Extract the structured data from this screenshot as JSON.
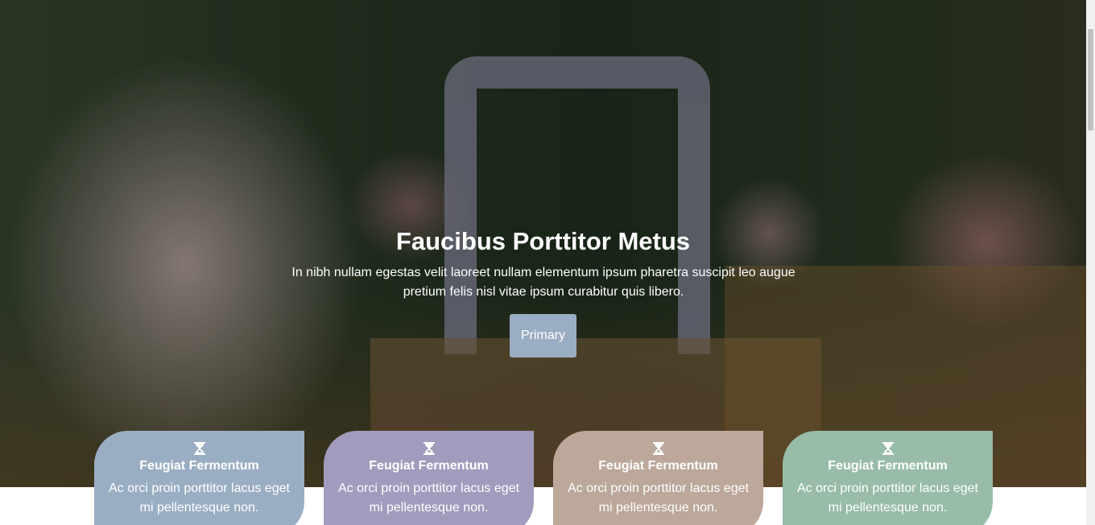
{
  "hero": {
    "title": "Faucibus Porttitor Metus",
    "text": "In nibh nullam egestas velit laoreet nullam elementum ipsum pharetra suscipit leo augue pretium felis nisl vitae ipsum curabitur quis libero.",
    "button_label": "Primary",
    "button_color": "#9aaec3"
  },
  "cards": [
    {
      "icon": "hourglass-icon",
      "title": "Feugiat Fermentum",
      "text": "Ac orci proin porttitor lacus eget mi pellentesque non.",
      "color": "#9aaec3"
    },
    {
      "icon": "hourglass-icon",
      "title": "Feugiat Fermentum",
      "text": "Ac orci proin porttitor lacus eget mi pellentesque non.",
      "color": "#a29bbd"
    },
    {
      "icon": "hourglass-icon",
      "title": "Feugiat Fermentum",
      "text": "Ac orci proin porttitor lacus eget mi pellentesque non.",
      "color": "#bca79a"
    },
    {
      "icon": "hourglass-icon",
      "title": "Feugiat Fermentum",
      "text": "Ac orci proin porttitor lacus eget mi pellentesque non.",
      "color": "#98bca8"
    }
  ]
}
